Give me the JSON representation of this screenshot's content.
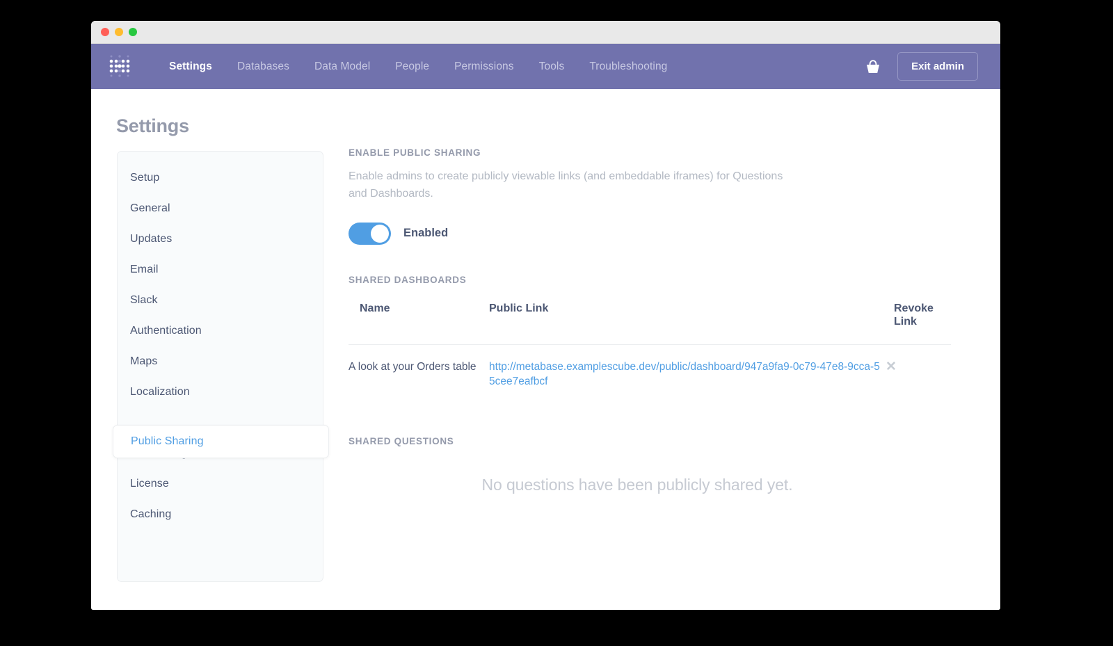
{
  "window": {
    "traffic_lights": [
      "close",
      "minimize",
      "zoom"
    ]
  },
  "nav": {
    "logo_icon": "metabase-dot-logo",
    "links": [
      {
        "label": "Settings",
        "active": true
      },
      {
        "label": "Databases",
        "active": false
      },
      {
        "label": "Data Model",
        "active": false
      },
      {
        "label": "People",
        "active": false
      },
      {
        "label": "Permissions",
        "active": false
      },
      {
        "label": "Tools",
        "active": false
      },
      {
        "label": "Troubleshooting",
        "active": false
      }
    ],
    "basket_icon": "basket-icon",
    "exit_admin_label": "Exit admin"
  },
  "page": {
    "title": "Settings"
  },
  "sidebar": {
    "items": [
      {
        "label": "Setup",
        "active": false
      },
      {
        "label": "General",
        "active": false
      },
      {
        "label": "Updates",
        "active": false
      },
      {
        "label": "Email",
        "active": false
      },
      {
        "label": "Slack",
        "active": false
      },
      {
        "label": "Authentication",
        "active": false
      },
      {
        "label": "Maps",
        "active": false
      },
      {
        "label": "Localization",
        "active": false
      },
      {
        "label": "Public Sharing",
        "active": true
      },
      {
        "label": "Embedding",
        "active": false
      },
      {
        "label": "License",
        "active": false
      },
      {
        "label": "Caching",
        "active": false
      }
    ]
  },
  "main": {
    "enable_sharing": {
      "heading": "ENABLE PUBLIC SHARING",
      "description": "Enable admins to create publicly viewable links (and embeddable iframes) for Questions and Dashboards.",
      "toggle_state": "on",
      "toggle_label": "Enabled"
    },
    "shared_dashboards": {
      "heading": "SHARED DASHBOARDS",
      "columns": [
        "Name",
        "Public Link",
        "Revoke Link"
      ],
      "rows": [
        {
          "name": "A look at your Orders table",
          "link": "http://metabase.examplescube.dev/public/dashboard/947a9fa9-0c79-47e8-9cca-55cee7eafbcf",
          "revoke_icon": "close-icon"
        }
      ]
    },
    "shared_questions": {
      "heading": "SHARED QUESTIONS",
      "empty_message": "No questions have been publicly shared yet."
    }
  },
  "colors": {
    "nav_background": "#7172ad",
    "accent_blue": "#509ee3",
    "text_primary": "#4c5773",
    "text_muted": "#949aab",
    "border": "#eceef0",
    "sidebar_background": "#f9fbfc"
  }
}
